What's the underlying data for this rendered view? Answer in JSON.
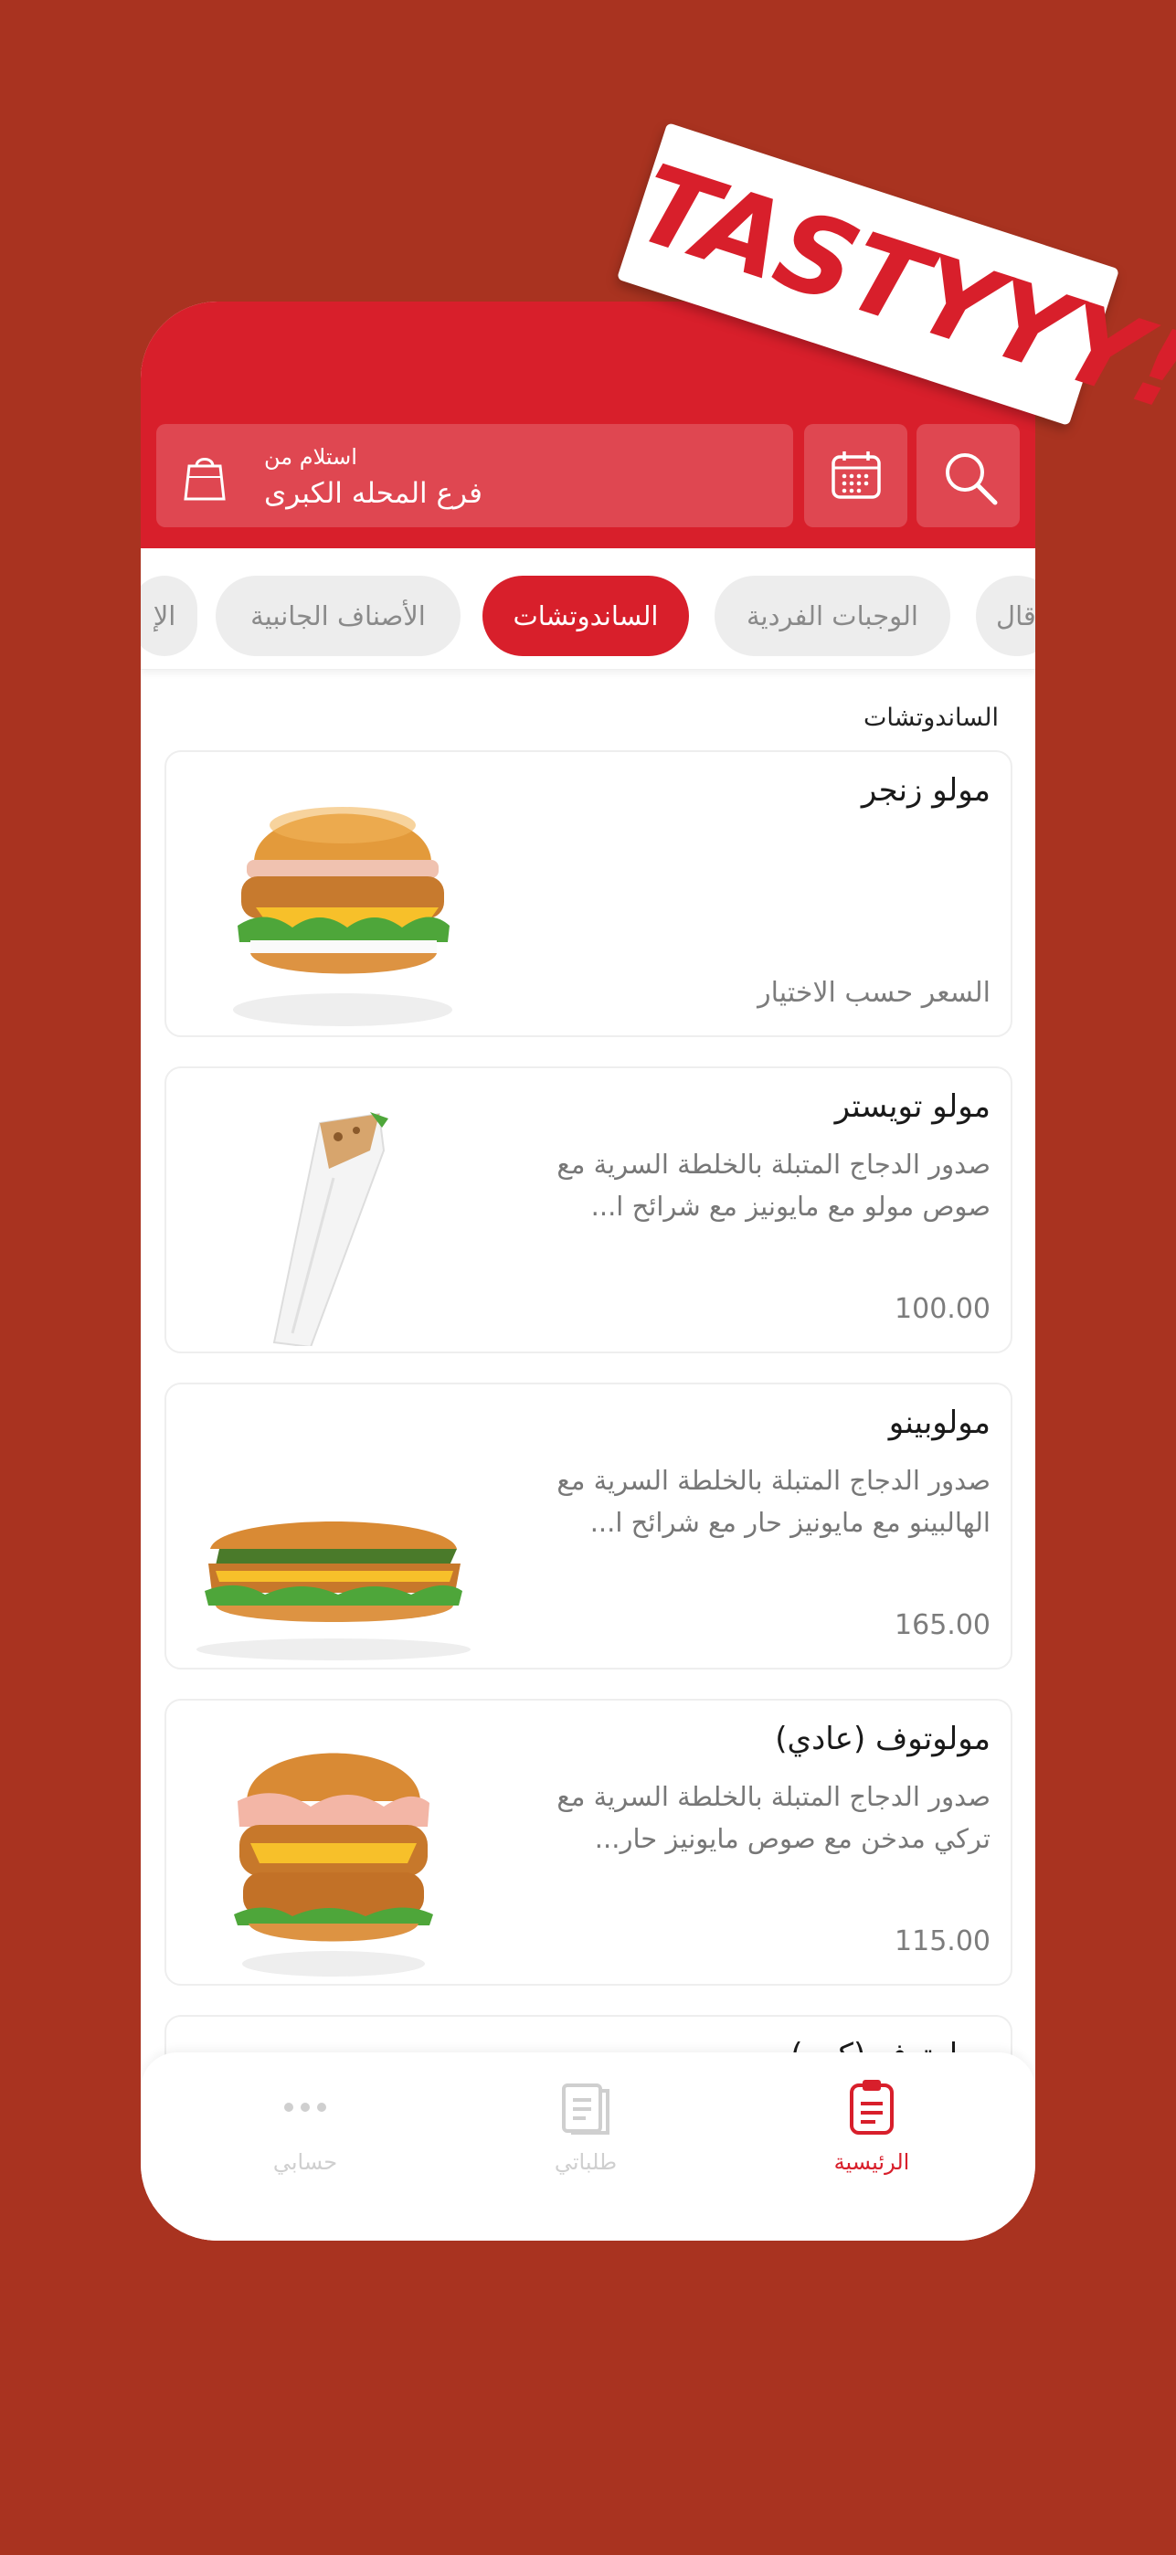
{
  "colors": {
    "background": "#a93320",
    "brand": "#d81f2b",
    "active_text": "#d81f2b",
    "inactive_nav": "#c8c8c8"
  },
  "sticker": {
    "text": "TASTYYY!"
  },
  "header": {
    "pickup_label": "استلام من",
    "pickup_branch": "فرع المحله الكبرى",
    "icons": [
      "bag-icon",
      "calendar-icon",
      "search-icon"
    ]
  },
  "tabs": [
    {
      "label": "الإ"
    },
    {
      "label": "الأصناف الجانبية"
    },
    {
      "label": "الساندوتشات",
      "active": true
    },
    {
      "label": "الوجبات الفردية"
    },
    {
      "label": "قال"
    }
  ],
  "section_title": "الساندوتشات",
  "products": [
    {
      "name": "مولو زنجر",
      "description": "",
      "price": "السعر حسب الاختيار",
      "image": "burger"
    },
    {
      "name": "مولو تويستر",
      "description": "صدور الدجاج المتبلة بالخلطة السرية مع صوص مولو مع مايونيز مع شرائح ا...",
      "price": "100.00",
      "image": "wrap"
    },
    {
      "name": "مولوبينو",
      "description": "صدور الدجاج المتبلة بالخلطة السرية مع الهالبينو مع مايونيز حار مع شرائح ا...",
      "price": "165.00",
      "image": "sub"
    },
    {
      "name": "مولوتوف (عادي)",
      "description": "صدور الدجاج المتبلة بالخلطة السرية مع تركي مدخن مع صوص مايونيز حار...",
      "price": "115.00",
      "image": "burger"
    },
    {
      "name": "مولوتوف (كبير)"
    }
  ],
  "bottom_nav": [
    {
      "label": "الرئيسية",
      "icon": "home-document-icon",
      "active": true
    },
    {
      "label": "طلباتي",
      "icon": "orders-icon",
      "active": false
    },
    {
      "label": "حسابي",
      "icon": "more-dots-icon",
      "active": false
    }
  ]
}
